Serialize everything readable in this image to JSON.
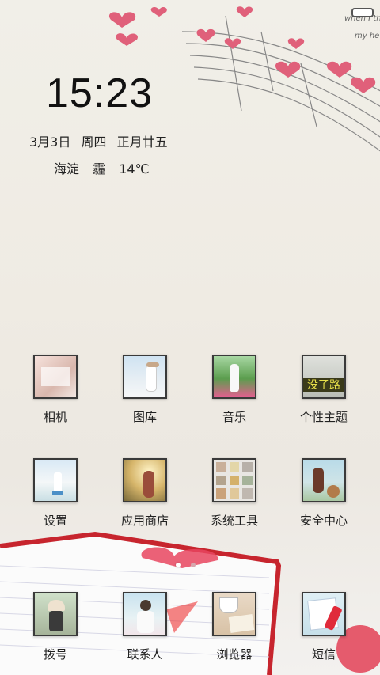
{
  "status": {
    "battery_icon": "battery-icon"
  },
  "lock": {
    "time": "15:23",
    "date": "3月3日",
    "weekday": "周四",
    "lunar": "正月廿五",
    "location": "海淀",
    "weather": "霾",
    "temperature": "14℃"
  },
  "apps": [
    {
      "label": "相机",
      "icon": "camera-icon"
    },
    {
      "label": "图库",
      "icon": "gallery-icon"
    },
    {
      "label": "音乐",
      "icon": "music-icon"
    },
    {
      "label": "个性主题",
      "icon": "theme-icon",
      "badge": "没了路"
    },
    {
      "label": "设置",
      "icon": "settings-icon"
    },
    {
      "label": "应用商店",
      "icon": "app-store-icon"
    },
    {
      "label": "系统工具",
      "icon": "system-tools-icon"
    },
    {
      "label": "安全中心",
      "icon": "security-center-icon"
    }
  ],
  "dock": [
    {
      "label": "拨号",
      "icon": "phone-icon"
    },
    {
      "label": "联系人",
      "icon": "contacts-icon"
    },
    {
      "label": "浏览器",
      "icon": "browser-icon"
    },
    {
      "label": "短信",
      "icon": "messages-icon"
    }
  ],
  "wallpaper_text": [
    "when I th",
    "my he"
  ],
  "colors": {
    "heart": "#e0607a",
    "page_dot_active": "#ffffff",
    "page_dot_inactive": "#d7a6ad"
  }
}
